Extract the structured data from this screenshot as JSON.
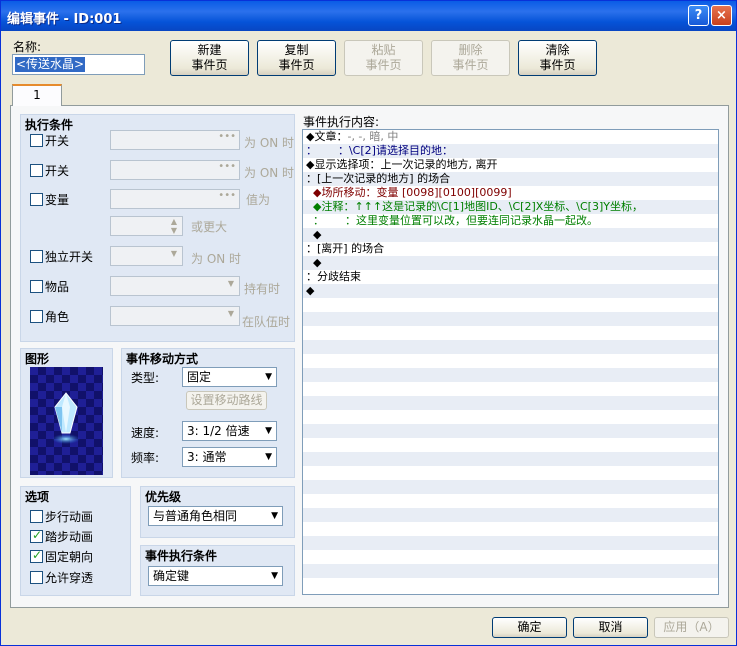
{
  "window": {
    "title": "编辑事件 - ID:001",
    "help_glyph": "?",
    "close_glyph": "×"
  },
  "name": {
    "label": "名称:",
    "value": "<传送水晶>"
  },
  "page_buttons": {
    "new": [
      "新建",
      "事件页"
    ],
    "copy": [
      "复制",
      "事件页"
    ],
    "paste": [
      "粘贴",
      "事件页"
    ],
    "delete": [
      "删除",
      "事件页"
    ],
    "clear": [
      "清除",
      "事件页"
    ]
  },
  "tab": {
    "label": "1"
  },
  "conditions": {
    "title": "执行条件",
    "switch1": {
      "label": "开关",
      "suffix": "为 ON 时",
      "checked": false
    },
    "switch2": {
      "label": "开关",
      "suffix": "为 ON 时",
      "checked": false
    },
    "variable": {
      "label": "变量",
      "suffix": "值为",
      "suffix2": "或更大",
      "checked": false
    },
    "self_switch": {
      "label": "独立开关",
      "suffix": "为 ON 时",
      "checked": false
    },
    "item": {
      "label": "物品",
      "suffix": "持有时",
      "checked": false
    },
    "actor": {
      "label": "角色",
      "suffix": "在队伍时",
      "checked": false
    }
  },
  "graphic": {
    "title": "图形"
  },
  "movement": {
    "title": "事件移动方式",
    "type_label": "类型:",
    "type_value": "固定",
    "route_button": "设置移动路线",
    "speed_label": "速度:",
    "speed_value": "3: 1/2 倍速",
    "freq_label": "频率:",
    "freq_value": "3: 通常"
  },
  "options": {
    "title": "选项",
    "items": [
      {
        "label": "步行动画",
        "checked": false
      },
      {
        "label": "踏步动画",
        "checked": true
      },
      {
        "label": "固定朝向",
        "checked": true
      },
      {
        "label": "允许穿透",
        "checked": false
      }
    ]
  },
  "priority": {
    "title": "优先级",
    "value": "与普通角色相同"
  },
  "trigger": {
    "title": "事件执行条件",
    "value": "确定键"
  },
  "commands": {
    "title": "事件执行内容:",
    "rows": [
      {
        "text": "◆文章：",
        "tail": "-, -, 暗, 中",
        "color": "#000000",
        "tail_color": "#808080"
      },
      {
        "text": "：      ：\\C[2]请选择目的地：",
        "color": "#00007f"
      },
      {
        "text": "◆显示选择项：上一次记录的地方, 离开",
        "color": "#000000"
      },
      {
        "text": "：[上一次记录的地方] 的场合",
        "color": "#000000"
      },
      {
        "text": "  ◆场所移动：变量 [0098][0100][0099]",
        "color": "#7f0000"
      },
      {
        "text": "  ◆注释：↑↑↑这是记录的\\C[1]地图ID、\\C[2]X坐标、\\C[3]Y坐标，",
        "color": "#007f00"
      },
      {
        "text": "  ：      ：这里变量位置可以改，但要连同记录水晶一起改。",
        "color": "#007f00"
      },
      {
        "text": "  ◆",
        "color": "#000000"
      },
      {
        "text": "：[离开] 的场合",
        "color": "#000000"
      },
      {
        "text": "  ◆",
        "color": "#000000"
      },
      {
        "text": "：分歧结束",
        "color": "#000000"
      },
      {
        "text": "◆",
        "color": "#000000"
      }
    ]
  },
  "footer": {
    "ok": "确定",
    "cancel": "取消",
    "apply": "应用（A）"
  },
  "colors": {
    "titlebar": "#0a5ce6",
    "group_bg": "#e0e8f4",
    "list_stripe": "#e8edf5"
  }
}
